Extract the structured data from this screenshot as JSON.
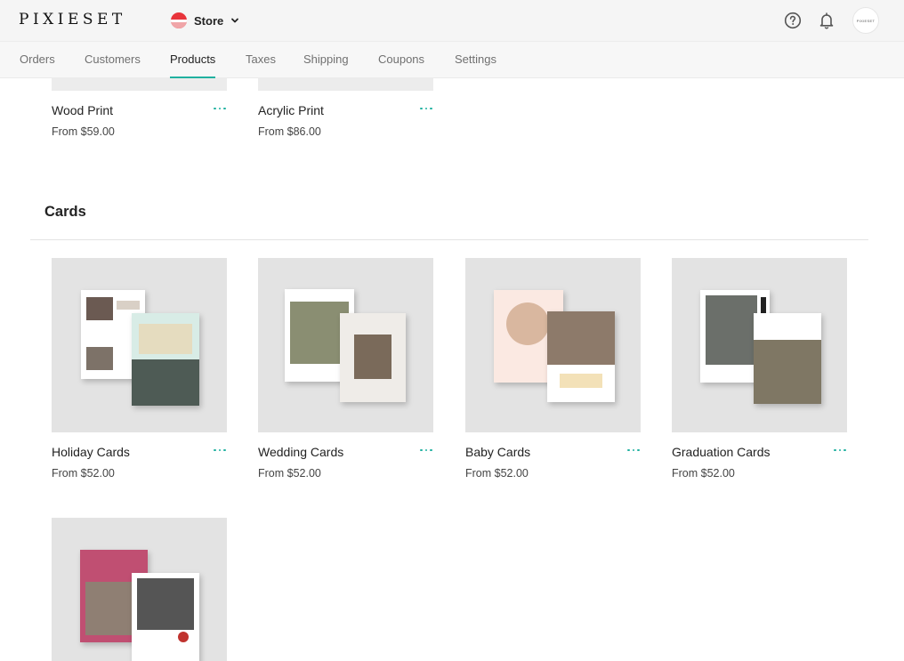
{
  "header": {
    "logo": "PIXIESET",
    "app_name": "Store",
    "avatar_text": "PIXIESET"
  },
  "tabs": [
    {
      "label": "Orders"
    },
    {
      "label": "Customers"
    },
    {
      "label": "Products"
    },
    {
      "label": "Taxes"
    },
    {
      "label": "Shipping"
    },
    {
      "label": "Coupons"
    },
    {
      "label": "Settings"
    }
  ],
  "active_tab": "Products",
  "prints": [
    {
      "name": "Wood Print",
      "price": "From $59.00"
    },
    {
      "name": "Acrylic Print",
      "price": "From $86.00"
    }
  ],
  "cards_section": {
    "title": "Cards",
    "items": [
      {
        "name": "Holiday Cards",
        "price": "From $52.00"
      },
      {
        "name": "Wedding Cards",
        "price": "From $52.00"
      },
      {
        "name": "Baby Cards",
        "price": "From $52.00"
      },
      {
        "name": "Graduation Cards",
        "price": "From $52.00"
      }
    ]
  },
  "colors": {
    "accent": "#21b1a0",
    "brand_red": "#e8343b",
    "topbar_bg": "#f5f5f5"
  },
  "icons": {
    "help": "help-circle-icon",
    "notifications": "bell-icon",
    "more": "more-dots-icon",
    "dropdown": "chevron-down-icon"
  }
}
